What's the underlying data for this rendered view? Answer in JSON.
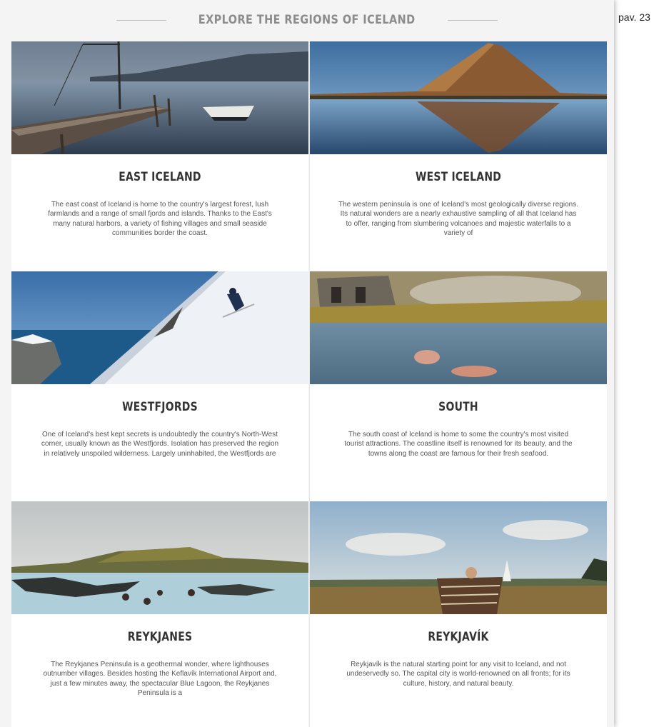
{
  "page_label": "pav. 23",
  "header": {
    "title": "EXPLORE THE REGIONS OF ICELAND"
  },
  "regions": [
    {
      "name": "EAST ICELAND",
      "description": "The east coast of Iceland is home to the country's largest forest, lush farmlands and a range of small fjords and islands. Thanks to the East's many natural harbors, a variety of fishing villages and small seaside communities border the coast."
    },
    {
      "name": "WEST ICELAND",
      "description": "The western peninsula is one of Iceland's most geologically diverse regions. Its natural wonders are a nearly exhaustive sampling of all that Iceland has to offer, ranging from slumbering volcanoes and majestic waterfalls to a variety of"
    },
    {
      "name": "WESTFJORDS",
      "description": "One of Iceland's best kept secrets is undoubtedly the country's North-West corner, usually known as the Westfjords. Isolation has preserved the region in relatively unspoiled wilderness. Largely uninhabited, the Westfjords are"
    },
    {
      "name": "SOUTH",
      "description": "The south coast of Iceland is home to some the country's most visited tourist attractions. The coastline itself is renowned for its beauty, and the towns along the coast are famous for their fresh seafood."
    },
    {
      "name": "REYKJANES",
      "description": "The Reykjanes Peninsula is a geothermal wonder, where lighthouses outnumber villages. Besides hosting the Keflavík International Airport and, just a few minutes away, the spectacular Blue Lagoon, the Reykjanes Peninsula is a"
    },
    {
      "name": "REYKJAVÍK",
      "description": "Reykjavík is the natural starting point for any visit to Iceland, and not undeservedly so. The capital city is world-renowned on all fronts; for its culture, history, and natural beauty."
    }
  ]
}
